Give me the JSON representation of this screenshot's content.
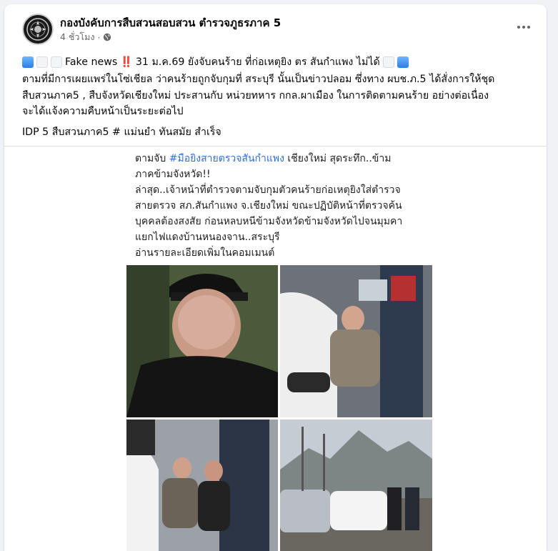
{
  "post": {
    "page_name": "กองบังคับการสืบสวนสอบสวน ตำรวจภูธรภาค 5",
    "time": "4 ชั่วโมง",
    "separator": "·",
    "more_icon": "more-horizontal-icon",
    "privacy_icon": "globe-icon",
    "line1_prefix": "Fake news",
    "line1_mark": "‼️",
    "line1_text": "31 ม.ค.69 ยังจับคนร้าย ที่ก่อเหตุยิง ตร สันกำแพง ไม่ได้",
    "line2a": "ตามที่มีการเผยแพร่ในโซ่เชียล ว่าคนร้ายถูกจับกุมที่ สระบุรี นั้นเป็นข่าวปลอม ซึ่งทาง ผบช.ภ.5 ได้สั่งการให้ชุด",
    "line2b": "สืบสวนภาค5 , สืบจังหวัดเชียงใหม่ ประสานกับ หน่วยทหาร กกล.ผาเมือง ในการติดตามคนร้าย อย่างต่อเนื่อง",
    "line2c": "จะได้แจ้งความคืบหน้าเป็นระยะต่อไป",
    "line3": "IDP 5 สืบสวนภาค5 # แม่นยำ ทันสมัย สำเร็จ"
  },
  "image": {
    "cap1_pre": "ตามจับ ",
    "cap1_hash": "#มือยิงสายตรวจสันกำแพง",
    "cap1_post": " เชียงใหม่ สุดระทึก..ข้าม",
    "cap2": "ภาคข้ามจังหวัด!!",
    "cap3": "ล่าสุด..เจ้าหน้าที่ตำรวจตามจับกุมตัวคนร้ายก่อเหตุยิงใส่ตำรวจ",
    "cap4": "สายตรวจ สภ.สันกำแพง จ.เชียงใหม่ ขณะปฏิบัติหน้าที่ตรวจค้น",
    "cap5": "บุคคลต้องสงสัย ก่อนหลบหนีข้ามจังหวัดข้ามจังหวัดไปจนมุมคา",
    "cap6": "แยกไฟแดงบ้านหนองจาน..สระบุรี",
    "cap7": "อ่านรายละเอียดเพิ่มในคอมเมนต์"
  },
  "colors": {
    "hashtag": "#2f6fd6",
    "secondary_text": "#65676b",
    "background": "#f0f2f5"
  }
}
